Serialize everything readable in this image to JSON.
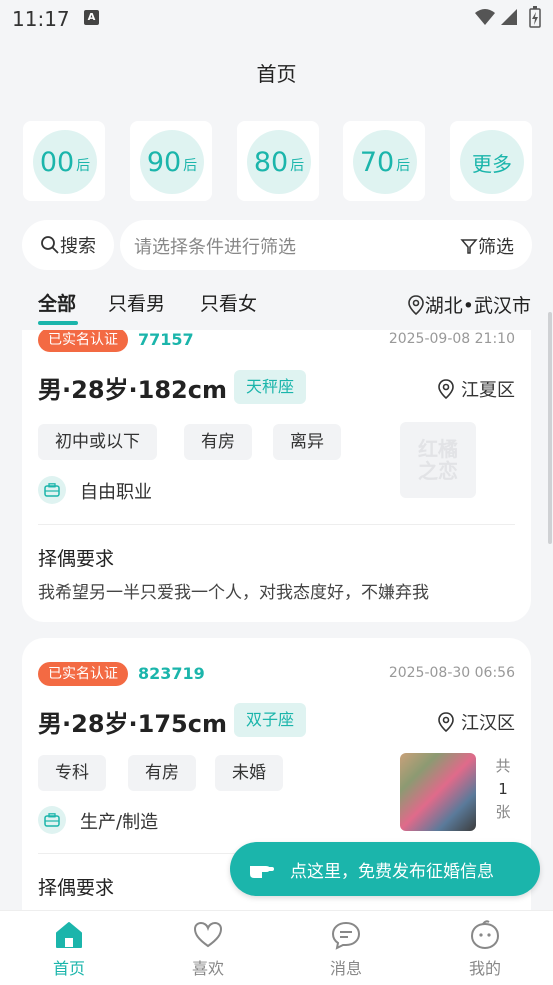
{
  "status_bar": {
    "time": "11:17",
    "app_icon_letter": "A"
  },
  "page": {
    "title": "首页"
  },
  "age_filters": [
    {
      "num": "00",
      "suffix": "后"
    },
    {
      "num": "90",
      "suffix": "后"
    },
    {
      "num": "80",
      "suffix": "后"
    },
    {
      "num": "70",
      "suffix": "后"
    },
    {
      "label": "更多"
    }
  ],
  "search": {
    "button_label": "搜索",
    "placeholder": "请选择条件进行筛选",
    "filter_label": "筛选"
  },
  "tabs": [
    {
      "label": "全部",
      "active": true
    },
    {
      "label": "只看男"
    },
    {
      "label": "只看女"
    }
  ],
  "location": {
    "label": "湖北•武汉市"
  },
  "cards": [
    {
      "verified": "已实名认证",
      "id": "77157",
      "date": "2025-09-08 21:10",
      "headline": "男·28岁·182cm",
      "zodiac": "天秤座",
      "district": "江夏区",
      "tags": [
        "初中或以下",
        "有房",
        "离异"
      ],
      "job": "自由职业",
      "watermark": "红橘之恋",
      "requirement_title": "择偶要求",
      "requirement": "我希望另一半只爱我一个人，对我态度好，不嫌弃我"
    },
    {
      "verified": "已实名认证",
      "id": "823719",
      "date": "2025-08-30 06:56",
      "headline": "男·28岁·175cm",
      "zodiac": "双子座",
      "district": "江汉区",
      "tags": [
        "专科",
        "有房",
        "未婚"
      ],
      "job": "生产/制造",
      "photo_count": {
        "prefix": "共",
        "count": "1",
        "suffix": "张"
      },
      "requirement_title": "择偶要求"
    }
  ],
  "cta": {
    "label": "点这里，免费发布征婚信息"
  },
  "bottom_nav": [
    {
      "label": "首页",
      "icon": "home-icon",
      "active": true
    },
    {
      "label": "喜欢",
      "icon": "heart-icon"
    },
    {
      "label": "消息",
      "icon": "message-icon"
    },
    {
      "label": "我的",
      "icon": "profile-icon"
    }
  ],
  "colors": {
    "accent": "#1bb5ab",
    "verified": "#f36a43",
    "background": "#f4f5f7"
  }
}
